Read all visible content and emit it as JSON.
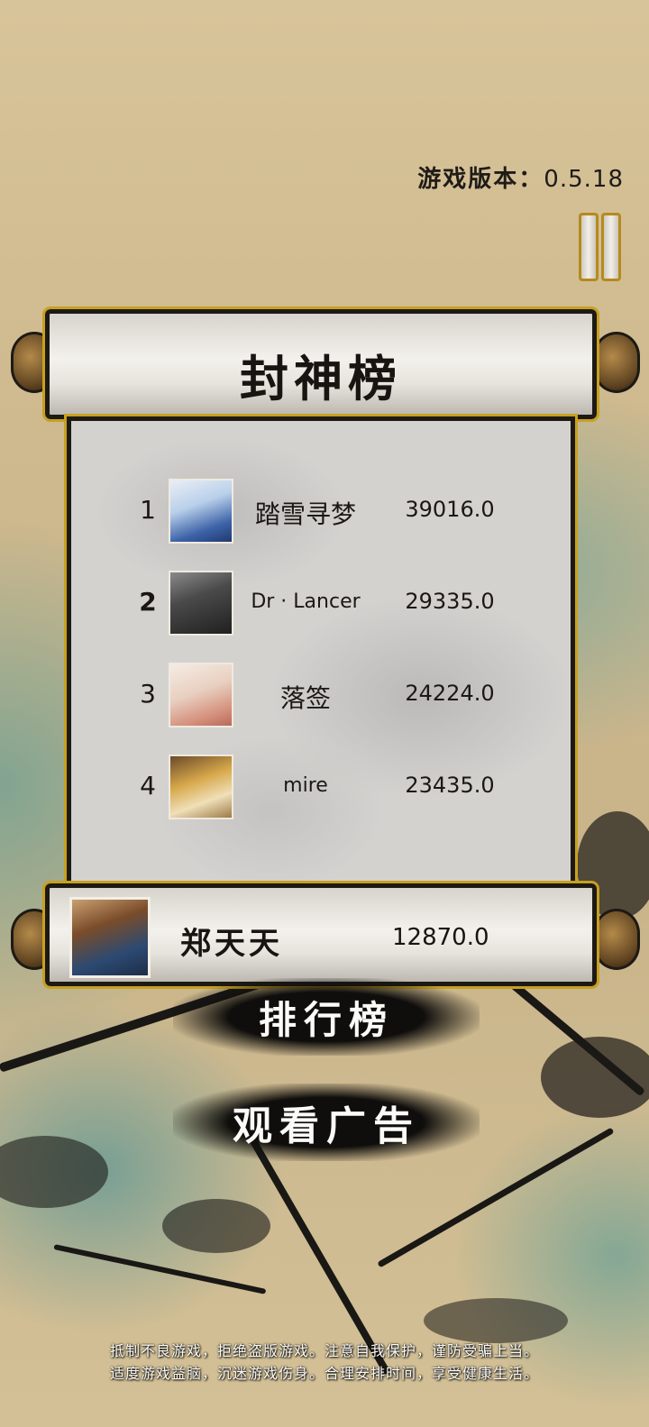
{
  "version": {
    "label": "游戏版本：",
    "number": "0.5.18"
  },
  "leaderboard": {
    "title": "封神榜",
    "entries": [
      {
        "rank": "1",
        "name": "踏雪寻梦",
        "score": "39016.0",
        "latin": false
      },
      {
        "rank": "2",
        "name": "Dr · Lancer",
        "score": "29335.0",
        "latin": true
      },
      {
        "rank": "3",
        "name": "落签",
        "score": "24224.0",
        "latin": false
      },
      {
        "rank": "4",
        "name": "mire",
        "score": "23435.0",
        "latin": true
      }
    ]
  },
  "self": {
    "name": "郑天天",
    "score": "12870.0"
  },
  "buttons": {
    "ranking": "排行榜",
    "watch_ad": "观看广告"
  },
  "notice": {
    "line1": "抵制不良游戏，拒绝盗版游戏。注意自我保护，谨防受骗上当。",
    "line2": "适度游戏益脑，沉迷游戏伤身。合理安排时间，享受健康生活。"
  },
  "colors": {
    "frame_gold": "#c8a020",
    "ink": "#1d1a15",
    "paper": "#f3f1ec"
  }
}
